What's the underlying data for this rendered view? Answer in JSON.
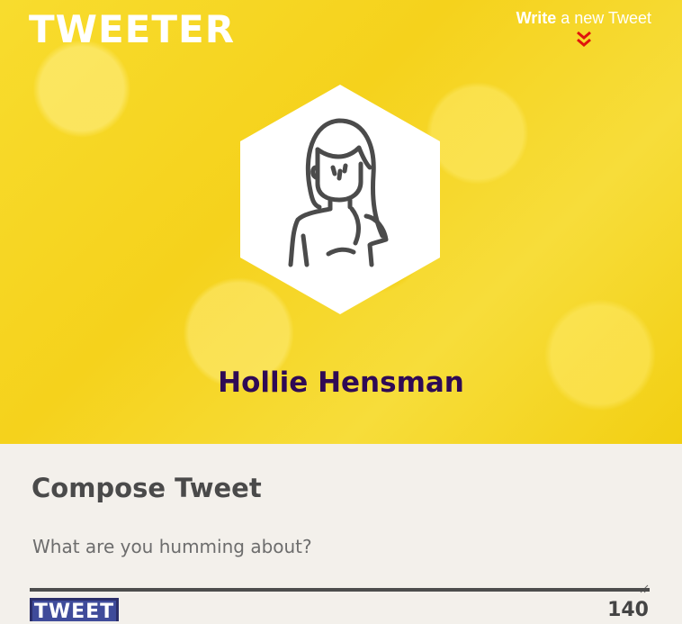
{
  "header": {
    "logo": "TWEETER",
    "compose_link": {
      "bold": "Write",
      "rest": " a new Tweet"
    },
    "compose_toggle_icon": "double-chevron-down-icon",
    "accent_color": "#e0140c"
  },
  "profile": {
    "avatar_icon": "user-avatar-icon",
    "name": "Hollie Hensman",
    "name_color": "#2f0a55",
    "hero_color": "#f5d21c"
  },
  "compose": {
    "title": "Compose Tweet",
    "placeholder": "What are you humming about?",
    "value": "",
    "button_label": "TWEET",
    "button_color": "#3f4b9a",
    "counter": "140"
  }
}
